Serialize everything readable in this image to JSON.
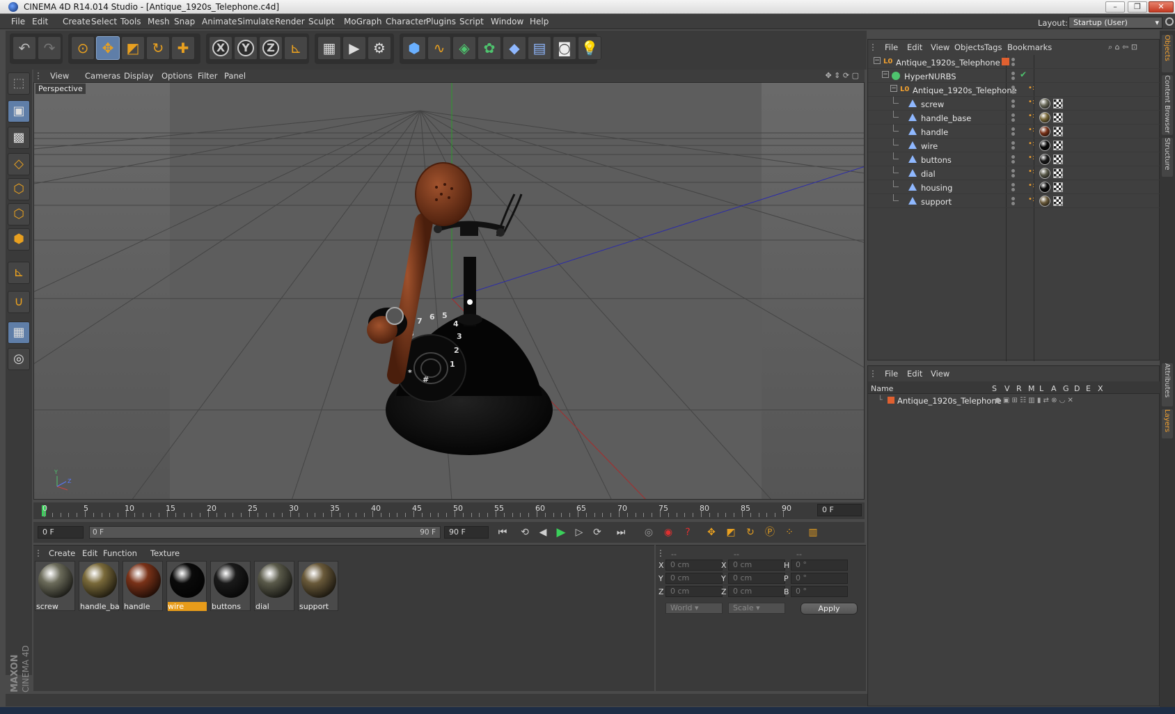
{
  "window": {
    "title": "CINEMA 4D R14.014 Studio - [Antique_1920s_Telephone.c4d]"
  },
  "menu": [
    "File",
    "Edit",
    "Create",
    "Select",
    "Tools",
    "Mesh",
    "Snap",
    "Animate",
    "Simulate",
    "Render",
    "Sculpt",
    "MoGraph",
    "Character",
    "Plugins",
    "Script",
    "Window",
    "Help"
  ],
  "layout": {
    "label": "Layout:",
    "value": "Startup (User)"
  },
  "viewport": {
    "menu": [
      "View",
      "Cameras",
      "Display",
      "Options",
      "Filter",
      "Panel"
    ],
    "label": "Perspective"
  },
  "timeline": {
    "ticks": [
      "0",
      "5",
      "10",
      "15",
      "20",
      "25",
      "30",
      "35",
      "40",
      "45",
      "50",
      "55",
      "60",
      "65",
      "70",
      "75",
      "80",
      "85",
      "90"
    ],
    "current_frame": "0 F",
    "start_frame": "0 F",
    "range_start": "0 F",
    "range_end": "90 F",
    "end_frame": "90 F"
  },
  "materials": {
    "menu": [
      "Create",
      "Edit",
      "Function",
      "Texture"
    ],
    "items": [
      {
        "name": "screw",
        "color": "#6b6b5a"
      },
      {
        "name": "handle_ba",
        "color": "#7a6a3a"
      },
      {
        "name": "handle",
        "color": "#7a3218"
      },
      {
        "name": "wire",
        "color": "#0a0a0a",
        "selected": true
      },
      {
        "name": "buttons",
        "color": "#1a1a1a"
      },
      {
        "name": "dial",
        "color": "#5a5a4a"
      },
      {
        "name": "support",
        "color": "#6a5a3a"
      }
    ]
  },
  "coords": {
    "header": [
      "--",
      "--",
      "--"
    ],
    "rows": [
      {
        "l1": "X",
        "v1": "0 cm",
        "l2": "X",
        "v2": "0 cm",
        "l3": "H",
        "v3": "0 °"
      },
      {
        "l1": "Y",
        "v1": "0 cm",
        "l2": "Y",
        "v2": "0 cm",
        "l3": "P",
        "v3": "0 °"
      },
      {
        "l1": "Z",
        "v1": "0 cm",
        "l2": "Z",
        "v2": "0 cm",
        "l3": "B",
        "v3": "0 °"
      }
    ],
    "space": "World",
    "mode": "Scale",
    "apply": "Apply"
  },
  "objects": {
    "menu": [
      "File",
      "Edit",
      "View",
      "Objects",
      "Tags",
      "Bookmarks"
    ],
    "items": [
      {
        "name": "Antique_1920s_Telephone",
        "type": "null",
        "level": 0
      },
      {
        "name": "HyperNURBS",
        "type": "nurbs",
        "level": 1
      },
      {
        "name": "Antique_1920s_Telephone",
        "type": "null",
        "level": 2
      },
      {
        "name": "screw",
        "type": "poly",
        "level": 3
      },
      {
        "name": "handle_base",
        "type": "poly",
        "level": 3
      },
      {
        "name": "handle",
        "type": "poly",
        "level": 3
      },
      {
        "name": "wire",
        "type": "poly",
        "level": 3
      },
      {
        "name": "buttons",
        "type": "poly",
        "level": 3
      },
      {
        "name": "dial",
        "type": "poly",
        "level": 3
      },
      {
        "name": "housing",
        "type": "poly",
        "level": 3
      },
      {
        "name": "support",
        "type": "poly",
        "level": 3
      }
    ]
  },
  "layers": {
    "menu": [
      "File",
      "Edit",
      "View"
    ],
    "headers": [
      "Name",
      "S",
      "V",
      "R",
      "M",
      "L",
      "A",
      "G",
      "D",
      "E",
      "X"
    ],
    "items": [
      {
        "name": "Antique_1920s_Telephone"
      }
    ]
  },
  "side_tabs": [
    "Objects",
    "Content Browser",
    "Structure",
    "Attributes",
    "Layers"
  ],
  "branding": {
    "line1": "MAXON",
    "line2": "CINEMA 4D"
  }
}
